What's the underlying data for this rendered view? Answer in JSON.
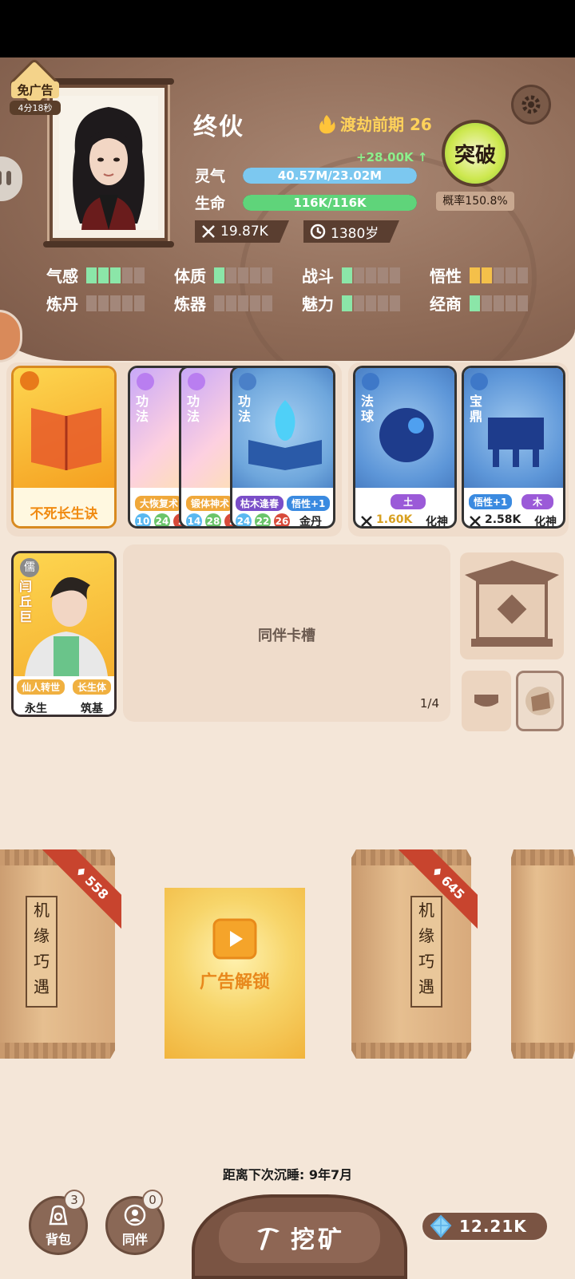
{
  "header": {
    "no_ad_label": "免广告",
    "no_ad_timer": "4分18秒",
    "name": "终伙",
    "realm": "渡劫前期 26",
    "qi_gain": "+28.00K ↑",
    "qi_label": "灵气",
    "qi_value": "40.57M/23.02M",
    "qi_fill": 1.0,
    "life_label": "生命",
    "life_value": "116K/116K",
    "life_fill": 1.0,
    "power": "19.87K",
    "age": "1380岁",
    "breakthrough_label": "突破",
    "breakthrough_prob": "概率150.8%"
  },
  "attributes": [
    {
      "name": "气感",
      "level": 3,
      "color": "green"
    },
    {
      "name": "体质",
      "level": 1,
      "color": "green"
    },
    {
      "name": "战斗",
      "level": 1,
      "color": "green"
    },
    {
      "name": "悟性",
      "level": 2,
      "color": "yellow"
    },
    {
      "name": "炼丹",
      "level": 0,
      "color": "green"
    },
    {
      "name": "炼器",
      "level": 0,
      "color": "green"
    },
    {
      "name": "魅力",
      "level": 1,
      "color": "green"
    },
    {
      "name": "经商",
      "level": 1,
      "color": "green"
    }
  ],
  "cards": {
    "main_skill": {
      "title": "不死长生诀"
    },
    "skill1": {
      "type": "功法",
      "tag": "大恢复术",
      "nums": [
        "10",
        "24",
        "2"
      ]
    },
    "skill2": {
      "type": "功法",
      "tag": "锻体神术",
      "nums": [
        "14",
        "28",
        "2"
      ]
    },
    "skill3": {
      "type": "功法",
      "tag": "枯木逢春",
      "tag2": "悟性+1",
      "nums": [
        "24",
        "22",
        "26"
      ],
      "realm": "金丹"
    },
    "orb": {
      "type": "法球",
      "element": "土",
      "power": "1.60K",
      "realm": "化神"
    },
    "cauldron": {
      "type": "宝鼎",
      "tag": "悟性+1",
      "element": "木",
      "power": "2.58K",
      "realm": "化神"
    }
  },
  "companion": {
    "school": "儒",
    "name": "闫丘巨",
    "tag1": "仙人转世",
    "tag2": "长生体",
    "life": "永生",
    "realm": "筑基",
    "slot_title": "同伴卡槽",
    "slot_count": "1/4"
  },
  "bags": [
    {
      "cost": "558",
      "text": [
        "机",
        "缘",
        "巧",
        "遇"
      ]
    },
    {
      "cost": "645",
      "text": [
        "机",
        "缘",
        "巧",
        "遇"
      ]
    }
  ],
  "ad_unlock": "广告解锁",
  "sleep_text": "距离下次沉睡: 9年7月",
  "bottom": {
    "bag_label": "背包",
    "bag_badge": "3",
    "companion_label": "同伴",
    "companion_badge": "0",
    "mine_label": "挖矿",
    "gems": "12.21K"
  },
  "colors": {
    "header_bg": "#8e6a56",
    "qi_bar": "#7cc8f0",
    "life_bar": "#5fd47a",
    "realm_gold": "#ffd25a"
  }
}
